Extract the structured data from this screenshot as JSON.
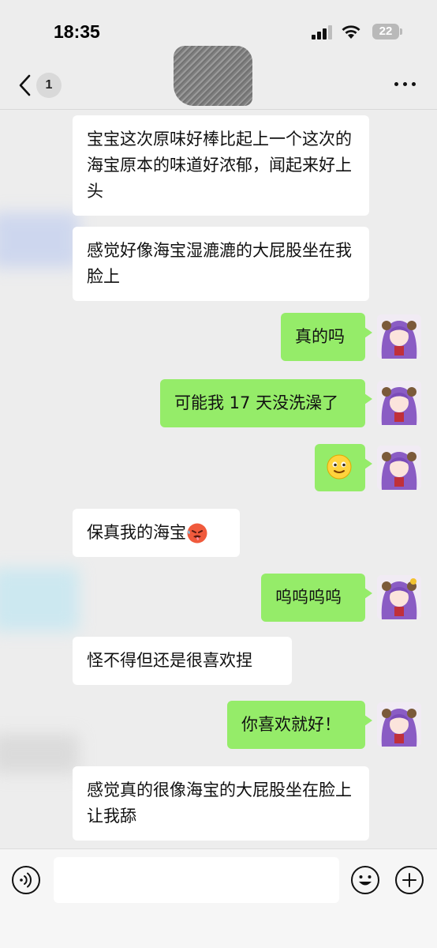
{
  "status_bar": {
    "time": "18:35",
    "battery_level": "22",
    "icons": [
      "signal-icon",
      "wifi-icon",
      "battery-icon"
    ]
  },
  "nav": {
    "unread_count": "1",
    "icons": [
      "chevron-left-icon",
      "more-icon"
    ]
  },
  "colors": {
    "background": "#ededed",
    "incoming_bubble": "#ffffff",
    "outgoing_bubble": "#95ec69"
  },
  "messages": [
    {
      "side": "in",
      "text": "宝宝这次原味好棒比起上一个这次的海宝原本的味道好浓郁，闻起来好上头"
    },
    {
      "side": "in",
      "text": "感觉好像海宝湿漉漉的大屁股坐在我脸上"
    },
    {
      "side": "out",
      "text": "真的吗"
    },
    {
      "side": "out",
      "text": "可能我 17 天没洗澡了"
    },
    {
      "side": "out",
      "text": "",
      "emoji": "smiling-face-icon"
    },
    {
      "side": "in",
      "text": "保真我的海宝",
      "emoji": "hot-face-icon"
    },
    {
      "side": "out",
      "text": "呜呜呜呜"
    },
    {
      "side": "in",
      "text": "怪不得但还是很喜欢捏"
    },
    {
      "side": "out",
      "text": "你喜欢就好！"
    },
    {
      "side": "in",
      "text": "感觉真的很像海宝的大屁股坐在脸上让我舔"
    }
  ],
  "input_bar": {
    "placeholder": "",
    "icons": [
      "voice-icon",
      "emoji-icon",
      "plus-icon"
    ]
  }
}
